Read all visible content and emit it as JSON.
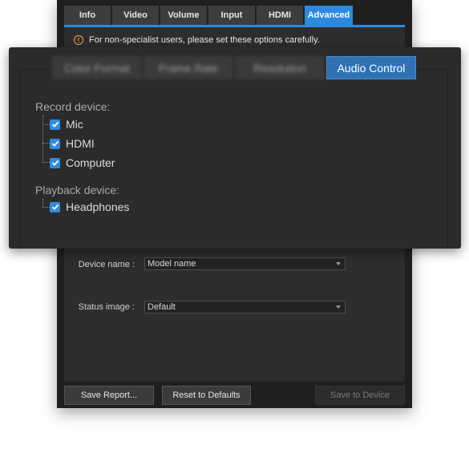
{
  "main_tabs": [
    {
      "label": "Info",
      "active": false
    },
    {
      "label": "Video",
      "active": false
    },
    {
      "label": "Volume",
      "active": false
    },
    {
      "label": "Input",
      "active": false
    },
    {
      "label": "HDMI",
      "active": false
    },
    {
      "label": "Advanced",
      "active": true
    }
  ],
  "warning": {
    "text": "For non-specialist users, please set these options carefully.",
    "icon": "warning-circle-icon",
    "color": "#f2a93b"
  },
  "sub_tabs": [
    {
      "label": "Color Format",
      "active": false
    },
    {
      "label": "Frame Rate",
      "active": false
    },
    {
      "label": "Resolution",
      "active": false
    },
    {
      "label": "Audio Control",
      "active": true
    }
  ],
  "record_device": {
    "label": "Record device:",
    "items": [
      {
        "label": "Mic",
        "checked": true
      },
      {
        "label": "HDMI",
        "checked": true
      },
      {
        "label": "Computer",
        "checked": true
      }
    ]
  },
  "playback_device": {
    "label": "Playback device:",
    "items": [
      {
        "label": "Headphones",
        "checked": true
      }
    ]
  },
  "form": {
    "device_name_label": "Device name :",
    "device_name_value": "Model name",
    "status_image_label": "Status image :",
    "status_image_value": "Default"
  },
  "buttons": {
    "save_report": "Save Report...",
    "reset_defaults": "Reset to Defaults",
    "save_device": "Save to Device"
  },
  "colors": {
    "accent": "#2b8ae0",
    "background": "#2b2b2b"
  }
}
